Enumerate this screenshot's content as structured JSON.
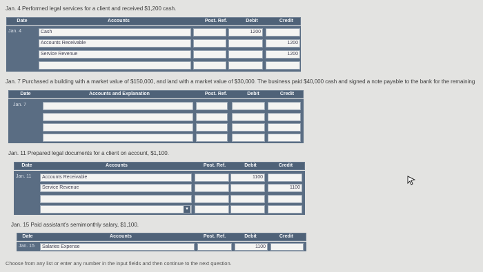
{
  "section1": {
    "prompt": "Jan. 4  Performed legal services for a client and received $1,200 cash.",
    "headers": [
      "Date",
      "Accounts",
      "Post. Ref.",
      "Debit",
      "Credit"
    ],
    "rows": [
      {
        "date": "Jan. 4",
        "account": "Cash",
        "debit": "1200",
        "credit": ""
      },
      {
        "date": "",
        "account": "Accounts Receivable",
        "debit": "",
        "credit": "1200"
      },
      {
        "date": "",
        "account": "Service Revenue",
        "debit": "",
        "credit": "1200"
      },
      {
        "date": "",
        "account": "",
        "debit": "",
        "credit": ""
      }
    ]
  },
  "section2": {
    "prompt": "Jan. 7  Purchased a building with a market value of $150,000, and land with a market value of $30,000. The business paid $40,000 cash and signed a note payable to the bank for the remaining",
    "headers": [
      "Date",
      "Accounts and Explanation",
      "Post. Ref.",
      "Debit",
      "Credit"
    ],
    "rows": [
      {
        "date": "Jan. 7",
        "account": "",
        "debit": "",
        "credit": ""
      },
      {
        "date": "",
        "account": "",
        "debit": "",
        "credit": ""
      },
      {
        "date": "",
        "account": "",
        "debit": "",
        "credit": ""
      },
      {
        "date": "",
        "account": "",
        "debit": "",
        "credit": ""
      }
    ]
  },
  "section3": {
    "prompt": "Jan. 11  Prepared legal documents for a client on account, $1,100.",
    "headers": [
      "Date",
      "Accounts",
      "Post. Ref.",
      "Debit",
      "Credit"
    ],
    "rows": [
      {
        "date": "Jan. 11",
        "account": "Accounts Receivable",
        "debit": "1100",
        "credit": ""
      },
      {
        "date": "",
        "account": "Service Revenue",
        "debit": "",
        "credit": "1100"
      },
      {
        "date": "",
        "account": "",
        "debit": "",
        "credit": ""
      },
      {
        "date": "",
        "account": "",
        "debit": "",
        "credit": ""
      }
    ]
  },
  "section4": {
    "prompt": "Jan. 15  Paid assistant's semimonthly salary, $1,100.",
    "headers": [
      "Date",
      "Accounts",
      "Post. Ref.",
      "Debit",
      "Credit"
    ],
    "rows": [
      {
        "date": "Jan. 15",
        "account": "Salaries Expense",
        "debit": "1100",
        "credit": ""
      }
    ]
  },
  "instruction": "Choose from any list or enter any number in the input fields and then continue to the next question."
}
